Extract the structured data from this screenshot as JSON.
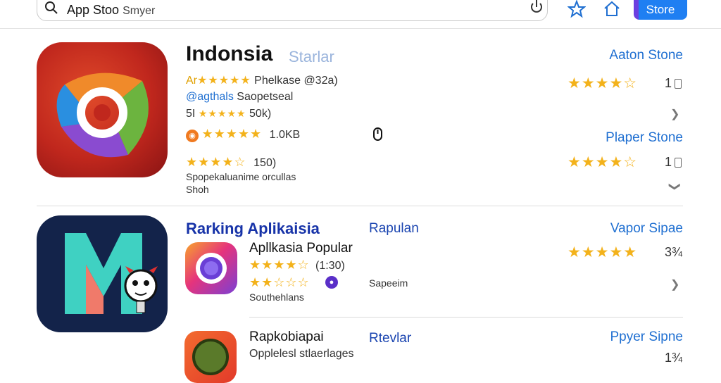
{
  "search": {
    "query": "App Stoo",
    "hint": "Smyer"
  },
  "header": {
    "store_button": "Store"
  },
  "section1": {
    "title": "Indonsia",
    "subtitle": "Starlar",
    "rows": [
      {
        "prefix": "Ar",
        "stars": "★★★★★",
        "text": "Phelkase @32a)"
      },
      {
        "prefix": "@agthals",
        "stars": "",
        "text": "Saopetseal"
      },
      {
        "prefix": "5I",
        "stars": "★★★★★",
        "text": "50k)"
      },
      {
        "prefix": "",
        "stars": "★★★★★",
        "text": "1.0KB"
      },
      {
        "prefix": "",
        "stars": "★★★★☆",
        "text": "150)"
      }
    ],
    "description_line1": "Spopekaluanime orcullas",
    "description_line2": "Shoh",
    "right": [
      {
        "store": "Aaton Stone",
        "stars": "★★★★☆",
        "count": "1"
      },
      {
        "store": "Plaper Stone",
        "stars": "★★★★☆",
        "count": "1"
      }
    ]
  },
  "section2": {
    "title": "Rarking Aplikaisia",
    "subtitle": "Rapulan",
    "app_name": "Apllkasia Popular",
    "app_rating_stars": "★★★★☆",
    "app_rating_count": "(1:30)",
    "app_rating2_stars": "★★☆☆☆",
    "app_category": "Sapeeim",
    "app_desc": "Southehlans",
    "right": {
      "store": "Vapor Sipae",
      "stars": "★★★★★",
      "count": "3¾"
    }
  },
  "section3": {
    "title": "Rapkobiapai",
    "subtitle": "Rtevlar",
    "desc": "Opplelesl stlaerlages",
    "right": {
      "store": "Ppyer Sipne",
      "count": "1¾"
    }
  }
}
